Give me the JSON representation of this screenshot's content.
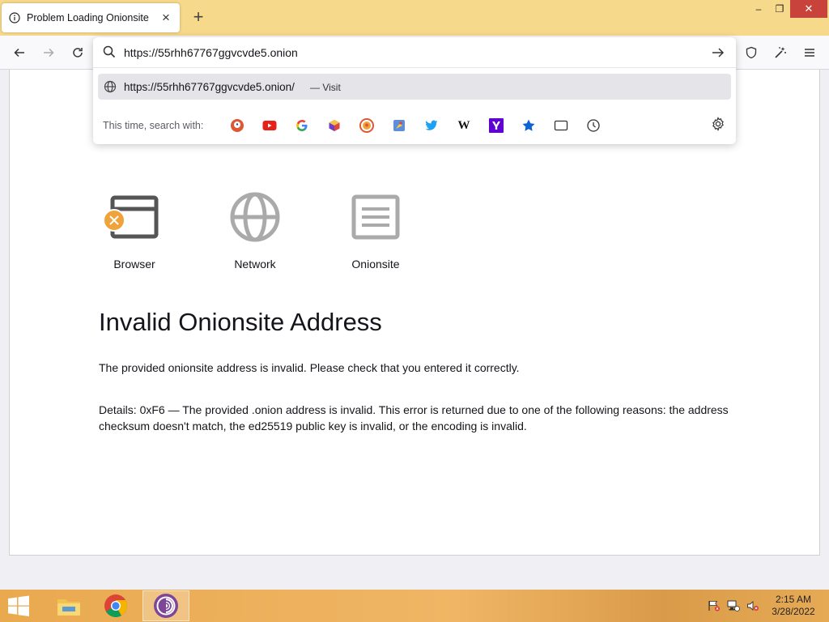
{
  "tab": {
    "title": "Problem Loading Onionsite"
  },
  "window": {
    "close_symbol": "✕",
    "min_symbol": "–",
    "restore_symbol": "❐"
  },
  "urlbar": {
    "value": "https://55rhh67767ggvcvde5.onion",
    "suggestion_url": "https://55rhh67767ggvcvde5.onion/",
    "suggestion_action": "— Visit",
    "search_with_label": "This time, search with:",
    "engines": [
      "DuckDuckGo",
      "YouTube",
      "Google",
      "Blockchair",
      "DuckDuckGo Onion",
      "Startpage",
      "Twitter",
      "Wikipedia",
      "Yahoo",
      "Bookmarks",
      "Tabs",
      "History"
    ]
  },
  "diagnostics": {
    "browser": "Browser",
    "network": "Network",
    "onionsite": "Onionsite"
  },
  "page": {
    "title": "Invalid Onionsite Address",
    "description": "The provided onionsite address is invalid. Please check that you entered it correctly.",
    "details": "Details: 0xF6 — The provided .onion address is invalid. This error is returned due to one of the following reasons: the address checksum doesn't match, the ed25519 public key is invalid, or the encoding is invalid."
  },
  "taskbar": {
    "time": "2:15 AM",
    "date": "3/28/2022"
  },
  "colors": {
    "titlebar": "#f7d98b",
    "error_badge": "#f0a23b",
    "taskbar": "#f0b665"
  }
}
